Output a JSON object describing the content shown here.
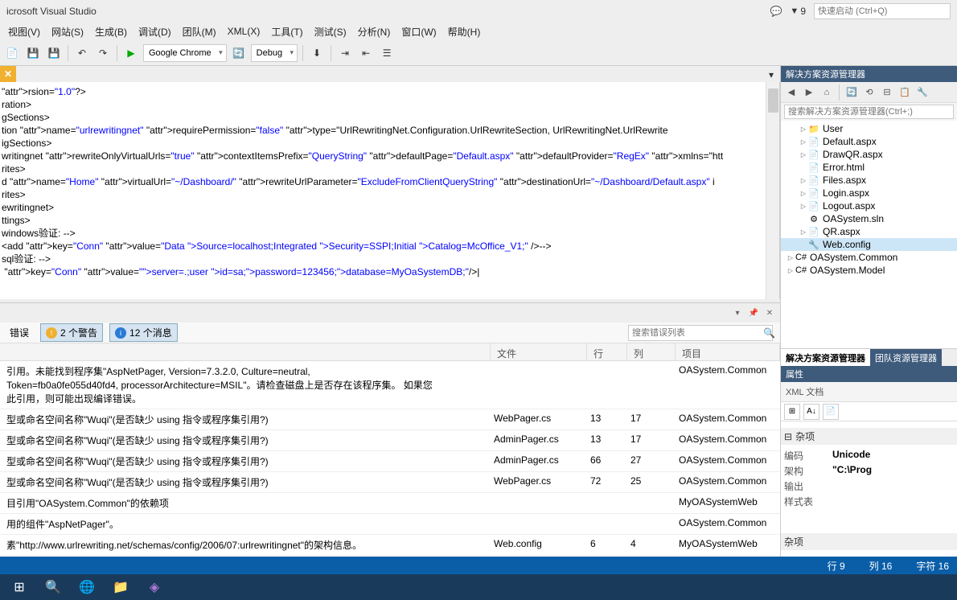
{
  "app_title": "icrosoft Visual Studio",
  "quick_launch_placeholder": "快速启动 (Ctrl+Q)",
  "notification_count": "9",
  "menu": [
    "视图(V)",
    "网站(S)",
    "生成(B)",
    "调试(D)",
    "团队(M)",
    "XML(X)",
    "工具(T)",
    "测试(S)",
    "分析(N)",
    "窗口(W)",
    "帮助(H)"
  ],
  "toolbar": {
    "browser": "Google Chrome",
    "config": "Debug"
  },
  "code_lines": [
    "rsion=\"1.0\"?>",
    "ration>",
    "gSections>",
    "tion name=\"urlrewritingnet\" requirePermission=\"false\" type=\"UrlRewritingNet.Configuration.UrlRewriteSection, UrlRewritingNet.UrlRewrite",
    "igSections>",
    "writingnet rewriteOnlyVirtualUrls=\"true\" contextItemsPrefix=\"QueryString\" defaultPage=\"Default.aspx\" defaultProvider=\"RegEx\" xmlns=\"htt",
    "rites>",
    "d name=\"Home\" virtualUrl=\"~/Dashboard/\" rewriteUrlParameter=\"ExcludeFromClientQueryString\" destinationUrl=\"~/Dashboard/Default.aspx\" i",
    "rites>",
    "ewritingnet>",
    "ttings>",
    "windows验证: -->",
    "<add key=\"Conn\" value=\"Data Source=localhost;Integrated Security=SSPI;Initial Catalog=McOffice_V1;\" />-->",
    "sql验证: -->",
    " key=\"Conn\" value=\"server=.;user id=sa;password=123456;database=MyOaSystemDB;\"/>|"
  ],
  "error_panel": {
    "errors_label": "错误",
    "warnings_label": "2 个警告",
    "messages_label": "12 个消息",
    "search_ph": "搜索错误列表",
    "cols": {
      "file": "文件",
      "line": "行",
      "col": "列",
      "proj": "项目"
    }
  },
  "errors": [
    {
      "desc": "引用。未能找到程序集\"AspNetPager, Version=7.3.2.0, Culture=neutral,\nToken=fb0a0fe055d40fd4, processorArchitecture=MSIL\"。请检查磁盘上是否存在该程序集。 如果您\n此引用，则可能出现编译错误。",
      "file": "",
      "line": "",
      "col": "",
      "proj": "OASystem.Common"
    },
    {
      "desc": "型或命名空间名称\"Wuqi\"(是否缺少 using 指令或程序集引用?)",
      "file": "WebPager.cs",
      "line": "13",
      "col": "17",
      "proj": "OASystem.Common"
    },
    {
      "desc": "型或命名空间名称\"Wuqi\"(是否缺少 using 指令或程序集引用?)",
      "file": "AdminPager.cs",
      "line": "13",
      "col": "17",
      "proj": "OASystem.Common"
    },
    {
      "desc": "型或命名空间名称\"Wuqi\"(是否缺少 using 指令或程序集引用?)",
      "file": "AdminPager.cs",
      "line": "66",
      "col": "27",
      "proj": "OASystem.Common"
    },
    {
      "desc": "型或命名空间名称\"Wuqi\"(是否缺少 using 指令或程序集引用?)",
      "file": "WebPager.cs",
      "line": "72",
      "col": "25",
      "proj": "OASystem.Common"
    },
    {
      "desc": "目引用\"OASystem.Common\"的依赖项",
      "file": "",
      "line": "",
      "col": "",
      "proj": "MyOASystemWeb"
    },
    {
      "desc": "用的组件\"AspNetPager\"。",
      "file": "",
      "line": "",
      "col": "",
      "proj": "OASystem.Common"
    },
    {
      "desc": "素\"http://www.urlrewriting.net/schemas/config/2006/07:urlrewritingnet\"的架构信息。",
      "file": "Web.config",
      "line": "6",
      "col": "4",
      "proj": "MyOASystemWeb"
    }
  ],
  "solution": {
    "title": "解决方案资源管理器",
    "search_ph": "搜索解决方案资源管理器(Ctrl+;)",
    "items": [
      {
        "name": "User",
        "icon": "📁",
        "exp": true,
        "lvl": 2
      },
      {
        "name": "Default.aspx",
        "icon": "📄",
        "exp": true,
        "lvl": 2
      },
      {
        "name": "DrawQR.aspx",
        "icon": "📄",
        "exp": true,
        "lvl": 2
      },
      {
        "name": "Error.html",
        "icon": "📄",
        "exp": false,
        "lvl": 2
      },
      {
        "name": "Files.aspx",
        "icon": "📄",
        "exp": true,
        "lvl": 2
      },
      {
        "name": "Login.aspx",
        "icon": "📄",
        "exp": true,
        "lvl": 2
      },
      {
        "name": "Logout.aspx",
        "icon": "📄",
        "exp": true,
        "lvl": 2
      },
      {
        "name": "OASystem.sln",
        "icon": "⚙",
        "exp": false,
        "lvl": 2
      },
      {
        "name": "QR.aspx",
        "icon": "📄",
        "exp": true,
        "lvl": 2
      },
      {
        "name": "Web.config",
        "icon": "🔧",
        "exp": false,
        "lvl": 2,
        "sel": true
      },
      {
        "name": "OASystem.Common",
        "icon": "C#",
        "exp": true,
        "lvl": 1
      },
      {
        "name": "OASystem.Model",
        "icon": "C#",
        "exp": true,
        "lvl": 1
      }
    ],
    "tabs": {
      "a": "解决方案资源管理器",
      "b": "团队资源管理器"
    }
  },
  "props": {
    "title": "属性",
    "doc": "XML 文档",
    "cat": "杂项",
    "rows": [
      {
        "k": "编码",
        "v": "Unicode"
      },
      {
        "k": "架构",
        "v": "\"C:\\Prog"
      },
      {
        "k": "输出",
        "v": ""
      },
      {
        "k": "样式表",
        "v": ""
      }
    ],
    "footer": "杂项"
  },
  "status": {
    "line": "行 9",
    "col": "列 16",
    "ch": "字符 16"
  }
}
